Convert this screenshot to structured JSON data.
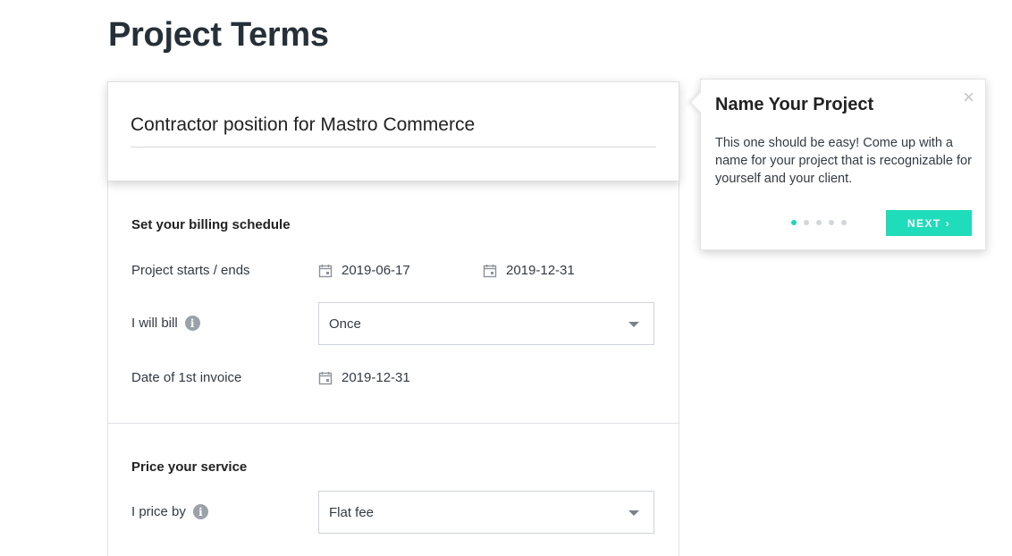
{
  "page": {
    "title": "Project Terms"
  },
  "project": {
    "name": "Contractor position for Mastro Commerce"
  },
  "billing": {
    "section_title": "Set your billing schedule",
    "starts_ends_label": "Project starts / ends",
    "start_date": "2019-06-17",
    "end_date": "2019-12-31",
    "bill_label": "I will bill",
    "bill_value": "Once",
    "first_invoice_label": "Date of 1st invoice",
    "first_invoice_date": "2019-12-31"
  },
  "pricing": {
    "section_title": "Price your service",
    "price_by_label": "I price by",
    "price_by_value": "Flat fee"
  },
  "popover": {
    "title": "Name Your Project",
    "body": "This one should be easy! Come up with a name for your project that is recognizable for yourself and your client.",
    "close_glyph": "×",
    "next_label": "NEXT ›",
    "steps_total": 5,
    "current_step": 1,
    "accent_color": "#1fdcba"
  },
  "icons": {
    "info": "i"
  }
}
